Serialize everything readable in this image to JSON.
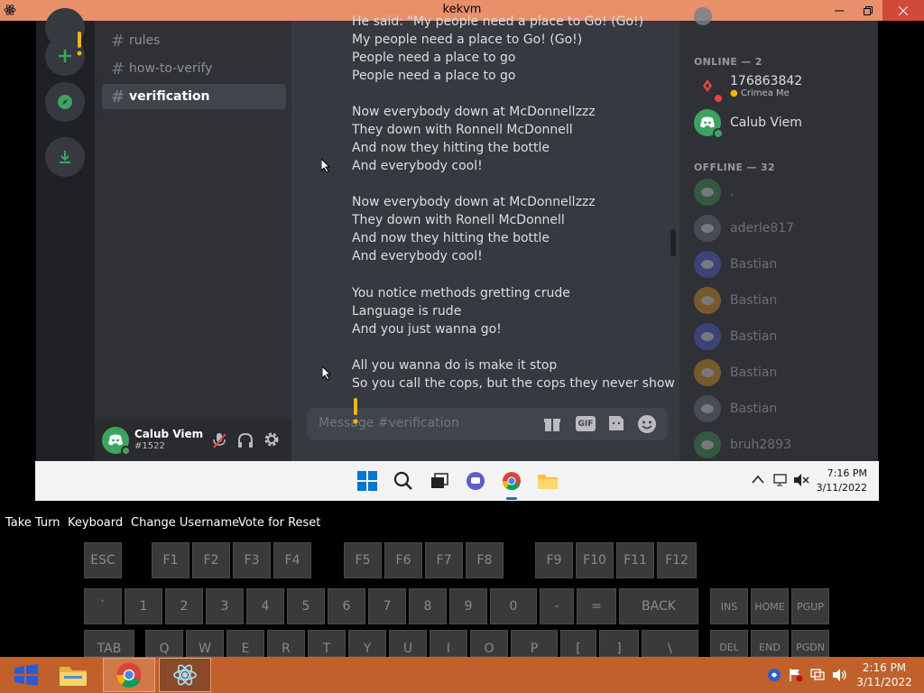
{
  "window": {
    "title": "kekvm"
  },
  "channels": [
    "rules",
    "how-to-verify",
    "verification"
  ],
  "user": {
    "name": "Calub Viem",
    "tag": "#1522"
  },
  "chat": {
    "lines": [
      "He said: \"My people need a place to Go! (Go!)",
      "My people need a place to Go! (Go!)",
      "People need a place to go",
      "People need a place to go",
      "Now everybody down at McDonnellzzz",
      "They down with Ronnell McDonnell",
      "And now they hitting the bottle",
      "And everybody cool!",
      "Now everybody down at McDonnellzzz",
      "They down with Ronell McDonnell",
      "And now they hitting the bottle",
      "And everybody cool!",
      "You notice methods gretting crude",
      "Language is rude",
      "And you just wanna go!",
      "All you wanna do is make it stop",
      "So you call the cops, but the cops they never show"
    ],
    "input_placeholder": "Message #verification",
    "gif_label": "GIF"
  },
  "members": {
    "online_header": "ONLINE — 2",
    "offline_header": "OFFLINE — 32",
    "online": [
      {
        "name": "176863842",
        "status": "Crimea Me",
        "color": "#2f3136"
      },
      {
        "name": "Calub Viem",
        "color": "#3ba55d"
      }
    ],
    "offline": [
      {
        "name": ".",
        "color": "#3ba55d"
      },
      {
        "name": "aderle817",
        "color": "#747f8d"
      },
      {
        "name": "Bastian",
        "color": "#5865f2"
      },
      {
        "name": "Bastian",
        "color": "#faa61a"
      },
      {
        "name": "Bastian",
        "color": "#5865f2"
      },
      {
        "name": "Bastian",
        "color": "#faa61a"
      },
      {
        "name": "Bastian",
        "color": "#747f8d"
      },
      {
        "name": "bruh2893",
        "color": "#3ba55d"
      }
    ]
  },
  "inner_taskbar": {
    "time": "7:16 PM",
    "date": "3/11/2022"
  },
  "vm_controls": [
    "Take Turn",
    "Keyboard",
    "Change Username",
    "Vote for Reset"
  ],
  "keyboard": {
    "row1": [
      "ESC",
      "F1",
      "F2",
      "F3",
      "F4",
      "F5",
      "F6",
      "F7",
      "F8",
      "F9",
      "F10",
      "F11",
      "F12"
    ],
    "row2": [
      "`",
      "1",
      "2",
      "3",
      "4",
      "5",
      "6",
      "7",
      "8",
      "9",
      "0",
      "-",
      "=",
      "BACK",
      "INS",
      "HOME",
      "PGUP"
    ],
    "row3": [
      "TAB",
      "Q",
      "W",
      "E",
      "R",
      "T",
      "Y",
      "U",
      "I",
      "O",
      "P",
      "[",
      "]",
      "\\",
      "DEL",
      "END",
      "PGDN"
    ]
  },
  "host_taskbar": {
    "time": "2:16 PM",
    "date": "3/11/2022"
  },
  "colors": {
    "discord_bg": "#36393f",
    "titlebar": "#e8906a",
    "host_taskbar": "#c0602a",
    "online_green": "#3ba55d"
  }
}
